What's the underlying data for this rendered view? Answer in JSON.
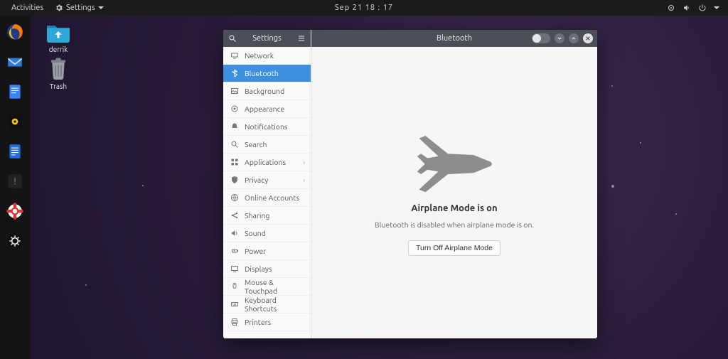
{
  "topbar": {
    "activities": "Activities",
    "appmenu": "Settings",
    "clock": "Sep 21  18 : 17"
  },
  "desktop": {
    "home_label": "derrik",
    "trash_label": "Trash"
  },
  "settings_window": {
    "sidebar_title": "Settings",
    "header_title": "Bluetooth",
    "items": [
      {
        "label": "Network",
        "submenu": false
      },
      {
        "label": "Bluetooth",
        "submenu": false
      },
      {
        "label": "Background",
        "submenu": false
      },
      {
        "label": "Appearance",
        "submenu": false
      },
      {
        "label": "Notifications",
        "submenu": false
      },
      {
        "label": "Search",
        "submenu": false
      },
      {
        "label": "Applications",
        "submenu": true
      },
      {
        "label": "Privacy",
        "submenu": true
      },
      {
        "label": "Online Accounts",
        "submenu": false
      },
      {
        "label": "Sharing",
        "submenu": false
      },
      {
        "label": "Sound",
        "submenu": false
      },
      {
        "label": "Power",
        "submenu": false
      },
      {
        "label": "Displays",
        "submenu": false
      },
      {
        "label": "Mouse & Touchpad",
        "submenu": false
      },
      {
        "label": "Keyboard Shortcuts",
        "submenu": false
      },
      {
        "label": "Printers",
        "submenu": false
      }
    ],
    "selected_index": 1,
    "content": {
      "heading": "Airplane Mode is on",
      "subtext": "Bluetooth is disabled when airplane mode is on.",
      "button": "Turn Off Airplane Mode"
    }
  }
}
